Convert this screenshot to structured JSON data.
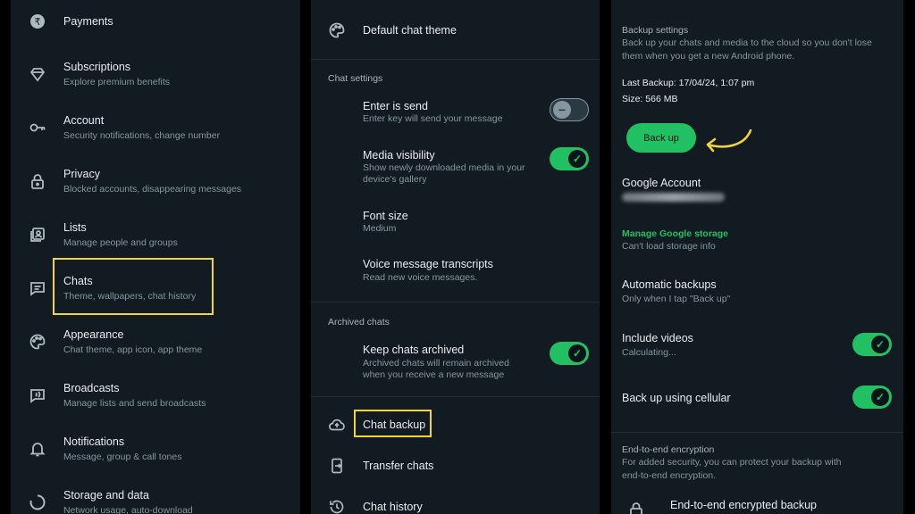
{
  "left_panel": {
    "items": [
      {
        "title": "Payments",
        "subtitle": "",
        "icon": "payments-icon"
      },
      {
        "title": "Subscriptions",
        "subtitle": "Explore premium benefits",
        "icon": "diamond-icon"
      },
      {
        "title": "Account",
        "subtitle": "Security notifications, change number",
        "icon": "key-icon"
      },
      {
        "title": "Privacy",
        "subtitle": "Blocked accounts, disappearing messages",
        "icon": "lock-icon"
      },
      {
        "title": "Lists",
        "subtitle": "Manage people and groups",
        "icon": "lists-icon"
      },
      {
        "title": "Chats",
        "subtitle": "Theme, wallpapers, chat history",
        "icon": "chat-icon"
      },
      {
        "title": "Appearance",
        "subtitle": "Chat theme, app icon, app theme",
        "icon": "palette-icon"
      },
      {
        "title": "Broadcasts",
        "subtitle": "Manage lists and send broadcasts",
        "icon": "broadcast-icon"
      },
      {
        "title": "Notifications",
        "subtitle": "Message, group & call tones",
        "icon": "bell-icon"
      },
      {
        "title": "Storage and data",
        "subtitle": "Network usage, auto-download",
        "icon": "storage-icon"
      }
    ]
  },
  "middle_panel": {
    "default_theme": "Default chat theme",
    "chat_settings_header": "Chat settings",
    "enter_send": {
      "title": "Enter is send",
      "subtitle": "Enter key will send your message"
    },
    "media_visibility": {
      "title": "Media visibility",
      "subtitle_1": "Show newly downloaded media in your",
      "subtitle_2": "device's gallery"
    },
    "font_size": {
      "title": "Font size",
      "subtitle": "Medium"
    },
    "voice_transcripts": {
      "title": "Voice message transcripts",
      "subtitle": "Read new voice messages."
    },
    "archived_header": "Archived chats",
    "keep_archived": {
      "title": "Keep chats archived",
      "subtitle_1": "Archived chats will remain archived",
      "subtitle_2": "when you receive a new message"
    },
    "chat_backup": "Chat backup",
    "transfer_chats": "Transfer chats",
    "chat_history": "Chat history"
  },
  "right_panel": {
    "backup_header": "Backup settings",
    "backup_desc_1": "Back up your chats and media to the cloud so you don't lose",
    "backup_desc_2": "them when you get a new Android phone.",
    "last_backup": "Last Backup: 17/04/24, 1:07 pm",
    "size": "Size: 566 MB",
    "back_up_button": "Back up",
    "google_account": "Google Account",
    "manage_storage": "Manage Google storage",
    "storage_info": "Can't load storage info",
    "automatic_backups": {
      "title": "Automatic backups",
      "subtitle": "Only when I tap \"Back up\""
    },
    "include_videos": {
      "title": "Include videos",
      "subtitle": "Calculating..."
    },
    "cellular": "Back up using cellular",
    "e2e_header": "End-to-end encryption",
    "e2e_desc_1": "For added security, you can protect your backup with",
    "e2e_desc_2": "end-to-end encryption.",
    "e2e_backup": "End-to-end encrypted backup"
  },
  "colors": {
    "accent": "#21c063",
    "highlight": "#f2d43a",
    "background": "#111b21"
  }
}
